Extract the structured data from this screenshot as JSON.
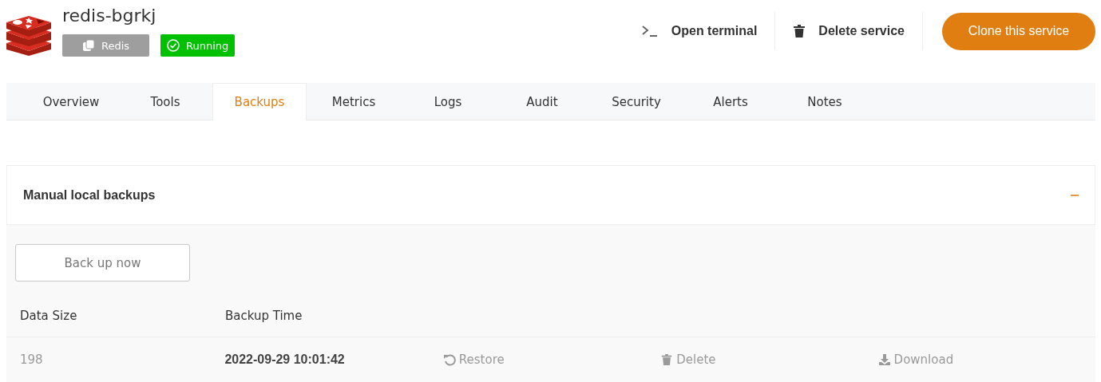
{
  "service": {
    "name": "redis-bgrkj",
    "type_badge": "Redis",
    "status": "Running",
    "running": true
  },
  "actions": [
    {
      "kind": "terminal",
      "label": "Open terminal"
    },
    {
      "kind": "delete",
      "label": "Delete service"
    },
    {
      "kind": "primary",
      "label": "Clone this service"
    }
  ],
  "tabs": [
    {
      "label": "Overview",
      "selected": false
    },
    {
      "label": "Tools",
      "selected": false
    },
    {
      "label": "Backups",
      "selected": true
    },
    {
      "label": "Metrics",
      "selected": false
    },
    {
      "label": "Logs",
      "selected": false
    },
    {
      "label": "Audit",
      "selected": false
    },
    {
      "label": "Security",
      "selected": false
    },
    {
      "label": "Alerts",
      "selected": false
    },
    {
      "label": "Notes",
      "selected": false
    }
  ],
  "section": {
    "title": "Manual local backups",
    "expanded": true,
    "backup_button": "Back up now"
  },
  "table": {
    "columns": [
      "Data Size",
      "Backup Time"
    ],
    "rows": [
      {
        "data_size": "198",
        "backup_time": "2022-09-29 10:01:42",
        "actions": [
          {
            "kind": "restore",
            "label": "Restore"
          },
          {
            "kind": "delete",
            "label": "Delete"
          },
          {
            "kind": "download",
            "label": "Download"
          }
        ]
      }
    ]
  }
}
